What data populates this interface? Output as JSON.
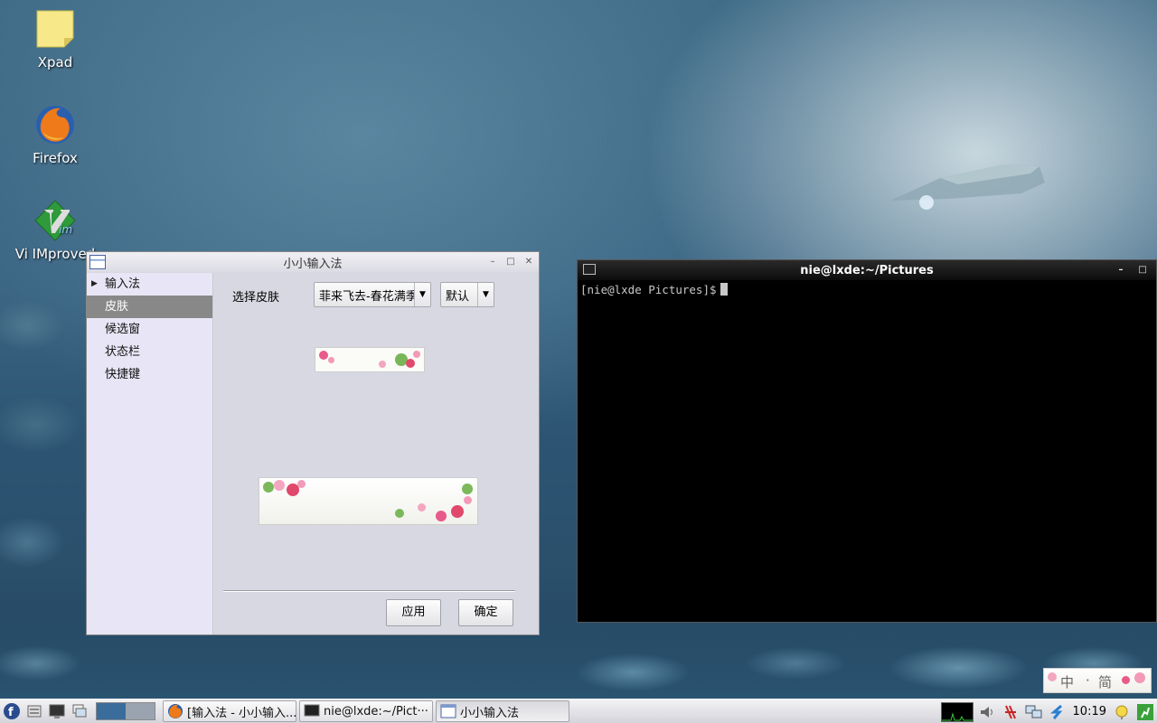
{
  "desktop": {
    "icons": [
      {
        "label": "Xpad"
      },
      {
        "label": "Firefox"
      },
      {
        "label": "Vi IMproved"
      }
    ]
  },
  "ime_window": {
    "title": "小小输入法",
    "sidebar": [
      {
        "label": "输入法",
        "expander": "▶"
      },
      {
        "label": "皮肤"
      },
      {
        "label": "候选窗"
      },
      {
        "label": "状态栏"
      },
      {
        "label": "快捷键"
      }
    ],
    "active_item": "皮肤",
    "skin_label": "选择皮肤",
    "skin_select_value": "菲来飞去-春花满季",
    "default_select_value": "默认",
    "apply_button": "应用",
    "ok_button": "确定",
    "controls": {
      "minimize": "–",
      "maximize": "□",
      "close": "✕"
    }
  },
  "terminal": {
    "title": "nie@lxde:~/Pictures",
    "prompt": "[nie@lxde Pictures]$",
    "controls": {
      "minimize": "–",
      "maximize": "□"
    }
  },
  "ime_status": {
    "mode": "中",
    "separator": "·",
    "script": "简"
  },
  "taskbar": {
    "tasks": [
      {
        "label": "[输入法 - 小小输入...",
        "icon": "firefox-icon"
      },
      {
        "label": "nie@lxde:~/Pict···",
        "icon": "terminal-icon"
      },
      {
        "label": "小小输入法",
        "icon": "window-icon",
        "active": true
      }
    ],
    "clock": "10:19"
  }
}
